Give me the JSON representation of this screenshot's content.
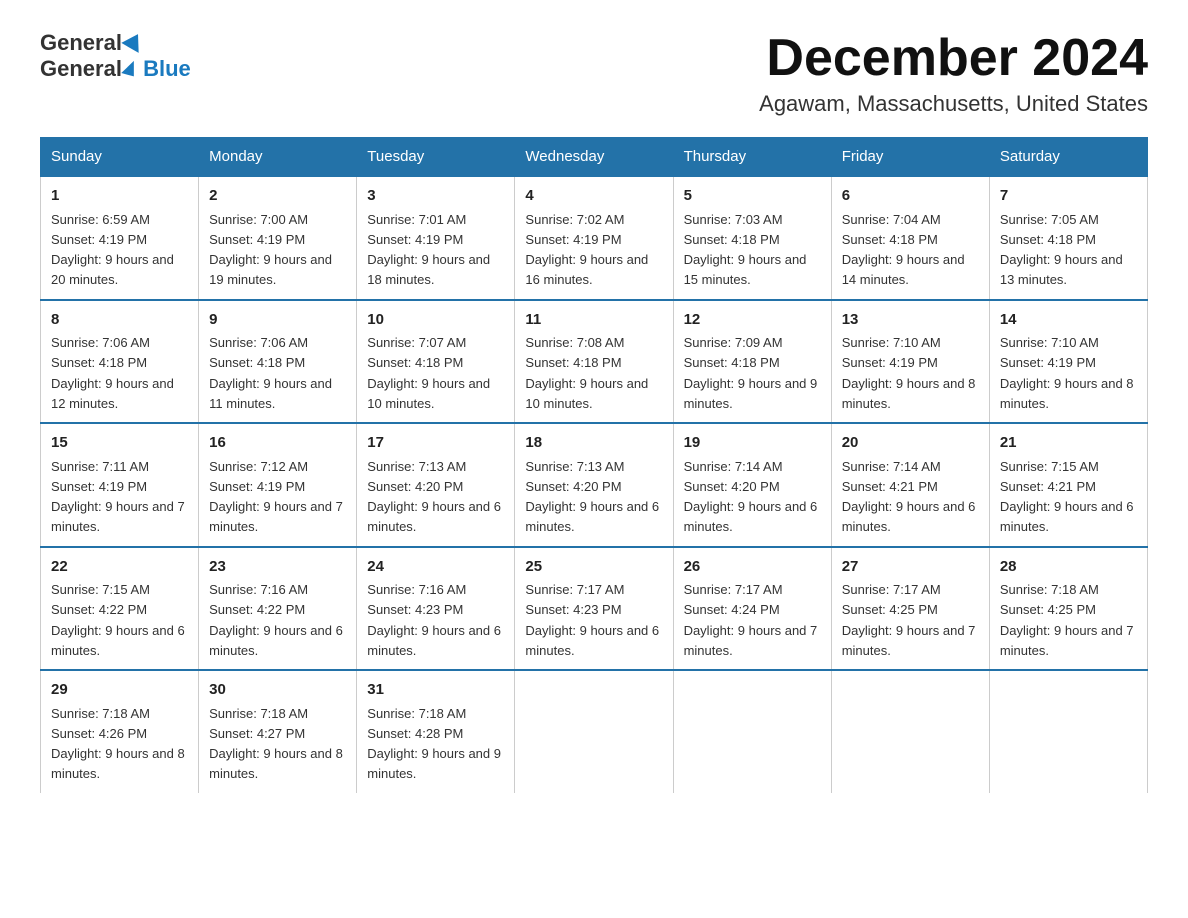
{
  "header": {
    "title": "December 2024",
    "subtitle": "Agawam, Massachusetts, United States"
  },
  "logo": {
    "general": "General",
    "blue": "Blue"
  },
  "days_of_week": [
    "Sunday",
    "Monday",
    "Tuesday",
    "Wednesday",
    "Thursday",
    "Friday",
    "Saturday"
  ],
  "weeks": [
    [
      {
        "num": "1",
        "sunrise": "Sunrise: 6:59 AM",
        "sunset": "Sunset: 4:19 PM",
        "daylight": "Daylight: 9 hours and 20 minutes."
      },
      {
        "num": "2",
        "sunrise": "Sunrise: 7:00 AM",
        "sunset": "Sunset: 4:19 PM",
        "daylight": "Daylight: 9 hours and 19 minutes."
      },
      {
        "num": "3",
        "sunrise": "Sunrise: 7:01 AM",
        "sunset": "Sunset: 4:19 PM",
        "daylight": "Daylight: 9 hours and 18 minutes."
      },
      {
        "num": "4",
        "sunrise": "Sunrise: 7:02 AM",
        "sunset": "Sunset: 4:19 PM",
        "daylight": "Daylight: 9 hours and 16 minutes."
      },
      {
        "num": "5",
        "sunrise": "Sunrise: 7:03 AM",
        "sunset": "Sunset: 4:18 PM",
        "daylight": "Daylight: 9 hours and 15 minutes."
      },
      {
        "num": "6",
        "sunrise": "Sunrise: 7:04 AM",
        "sunset": "Sunset: 4:18 PM",
        "daylight": "Daylight: 9 hours and 14 minutes."
      },
      {
        "num": "7",
        "sunrise": "Sunrise: 7:05 AM",
        "sunset": "Sunset: 4:18 PM",
        "daylight": "Daylight: 9 hours and 13 minutes."
      }
    ],
    [
      {
        "num": "8",
        "sunrise": "Sunrise: 7:06 AM",
        "sunset": "Sunset: 4:18 PM",
        "daylight": "Daylight: 9 hours and 12 minutes."
      },
      {
        "num": "9",
        "sunrise": "Sunrise: 7:06 AM",
        "sunset": "Sunset: 4:18 PM",
        "daylight": "Daylight: 9 hours and 11 minutes."
      },
      {
        "num": "10",
        "sunrise": "Sunrise: 7:07 AM",
        "sunset": "Sunset: 4:18 PM",
        "daylight": "Daylight: 9 hours and 10 minutes."
      },
      {
        "num": "11",
        "sunrise": "Sunrise: 7:08 AM",
        "sunset": "Sunset: 4:18 PM",
        "daylight": "Daylight: 9 hours and 10 minutes."
      },
      {
        "num": "12",
        "sunrise": "Sunrise: 7:09 AM",
        "sunset": "Sunset: 4:18 PM",
        "daylight": "Daylight: 9 hours and 9 minutes."
      },
      {
        "num": "13",
        "sunrise": "Sunrise: 7:10 AM",
        "sunset": "Sunset: 4:19 PM",
        "daylight": "Daylight: 9 hours and 8 minutes."
      },
      {
        "num": "14",
        "sunrise": "Sunrise: 7:10 AM",
        "sunset": "Sunset: 4:19 PM",
        "daylight": "Daylight: 9 hours and 8 minutes."
      }
    ],
    [
      {
        "num": "15",
        "sunrise": "Sunrise: 7:11 AM",
        "sunset": "Sunset: 4:19 PM",
        "daylight": "Daylight: 9 hours and 7 minutes."
      },
      {
        "num": "16",
        "sunrise": "Sunrise: 7:12 AM",
        "sunset": "Sunset: 4:19 PM",
        "daylight": "Daylight: 9 hours and 7 minutes."
      },
      {
        "num": "17",
        "sunrise": "Sunrise: 7:13 AM",
        "sunset": "Sunset: 4:20 PM",
        "daylight": "Daylight: 9 hours and 6 minutes."
      },
      {
        "num": "18",
        "sunrise": "Sunrise: 7:13 AM",
        "sunset": "Sunset: 4:20 PM",
        "daylight": "Daylight: 9 hours and 6 minutes."
      },
      {
        "num": "19",
        "sunrise": "Sunrise: 7:14 AM",
        "sunset": "Sunset: 4:20 PM",
        "daylight": "Daylight: 9 hours and 6 minutes."
      },
      {
        "num": "20",
        "sunrise": "Sunrise: 7:14 AM",
        "sunset": "Sunset: 4:21 PM",
        "daylight": "Daylight: 9 hours and 6 minutes."
      },
      {
        "num": "21",
        "sunrise": "Sunrise: 7:15 AM",
        "sunset": "Sunset: 4:21 PM",
        "daylight": "Daylight: 9 hours and 6 minutes."
      }
    ],
    [
      {
        "num": "22",
        "sunrise": "Sunrise: 7:15 AM",
        "sunset": "Sunset: 4:22 PM",
        "daylight": "Daylight: 9 hours and 6 minutes."
      },
      {
        "num": "23",
        "sunrise": "Sunrise: 7:16 AM",
        "sunset": "Sunset: 4:22 PM",
        "daylight": "Daylight: 9 hours and 6 minutes."
      },
      {
        "num": "24",
        "sunrise": "Sunrise: 7:16 AM",
        "sunset": "Sunset: 4:23 PM",
        "daylight": "Daylight: 9 hours and 6 minutes."
      },
      {
        "num": "25",
        "sunrise": "Sunrise: 7:17 AM",
        "sunset": "Sunset: 4:23 PM",
        "daylight": "Daylight: 9 hours and 6 minutes."
      },
      {
        "num": "26",
        "sunrise": "Sunrise: 7:17 AM",
        "sunset": "Sunset: 4:24 PM",
        "daylight": "Daylight: 9 hours and 7 minutes."
      },
      {
        "num": "27",
        "sunrise": "Sunrise: 7:17 AM",
        "sunset": "Sunset: 4:25 PM",
        "daylight": "Daylight: 9 hours and 7 minutes."
      },
      {
        "num": "28",
        "sunrise": "Sunrise: 7:18 AM",
        "sunset": "Sunset: 4:25 PM",
        "daylight": "Daylight: 9 hours and 7 minutes."
      }
    ],
    [
      {
        "num": "29",
        "sunrise": "Sunrise: 7:18 AM",
        "sunset": "Sunset: 4:26 PM",
        "daylight": "Daylight: 9 hours and 8 minutes."
      },
      {
        "num": "30",
        "sunrise": "Sunrise: 7:18 AM",
        "sunset": "Sunset: 4:27 PM",
        "daylight": "Daylight: 9 hours and 8 minutes."
      },
      {
        "num": "31",
        "sunrise": "Sunrise: 7:18 AM",
        "sunset": "Sunset: 4:28 PM",
        "daylight": "Daylight: 9 hours and 9 minutes."
      },
      {
        "num": "",
        "sunrise": "",
        "sunset": "",
        "daylight": ""
      },
      {
        "num": "",
        "sunrise": "",
        "sunset": "",
        "daylight": ""
      },
      {
        "num": "",
        "sunrise": "",
        "sunset": "",
        "daylight": ""
      },
      {
        "num": "",
        "sunrise": "",
        "sunset": "",
        "daylight": ""
      }
    ]
  ]
}
